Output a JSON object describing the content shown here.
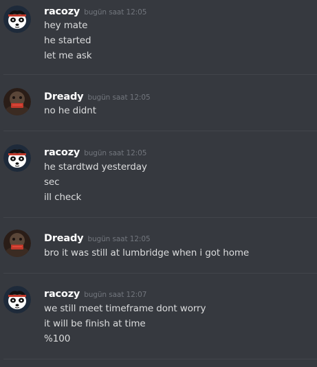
{
  "colors": {
    "background": "#36393f",
    "username": "#ffffff",
    "timestamp": "#72767d",
    "message_text": "#dcddde",
    "divider": "#42454b"
  },
  "messages": [
    {
      "author": "racozy",
      "avatar_icon": "panda-avatar-icon",
      "timestamp": "bugün saat 12:05",
      "lines": [
        "hey mate",
        "he started",
        "let me ask"
      ]
    },
    {
      "author": "Dready",
      "avatar_icon": "dready-avatar-icon",
      "timestamp": "bugün saat 12:05",
      "lines": [
        "no he didnt"
      ]
    },
    {
      "author": "racozy",
      "avatar_icon": "panda-avatar-icon",
      "timestamp": "bugün saat 12:05",
      "lines": [
        "he stardtwd yesterday",
        "sec",
        "ill check"
      ]
    },
    {
      "author": "Dready",
      "avatar_icon": "dready-avatar-icon",
      "timestamp": "bugün saat 12:05",
      "lines": [
        "bro it was still at lumbridge when i got home"
      ]
    },
    {
      "author": "racozy",
      "avatar_icon": "panda-avatar-icon",
      "timestamp": "bugün saat 12:07",
      "lines": [
        "we still meet timeframe dont worry",
        "it will be finish at time",
        "%100"
      ]
    }
  ]
}
